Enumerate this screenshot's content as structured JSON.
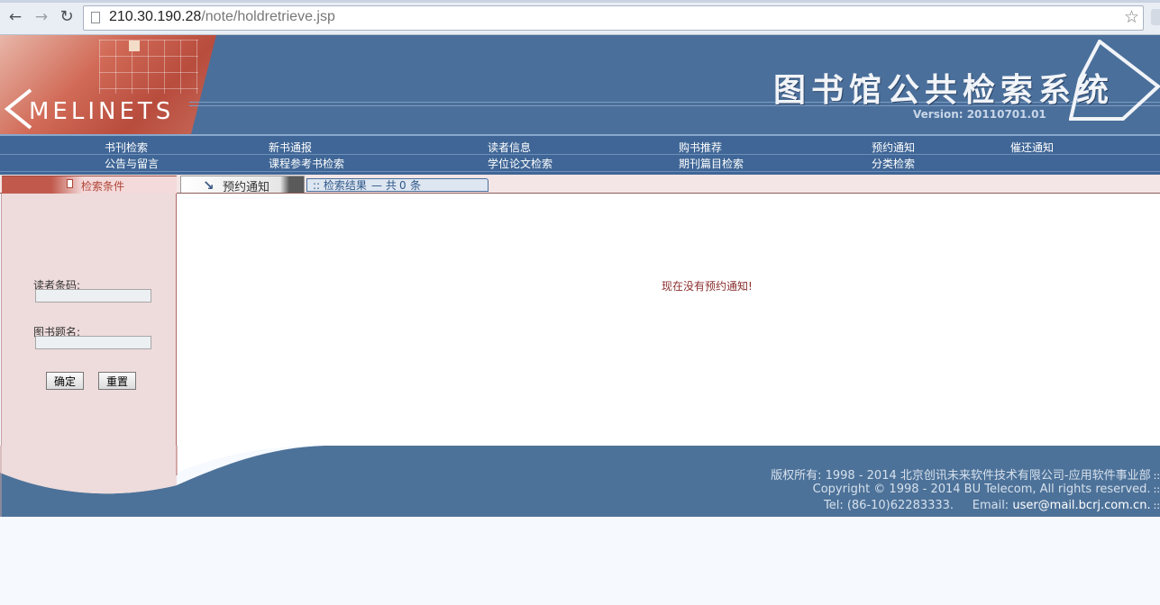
{
  "browser": {
    "url_host": "210.30.190.28",
    "url_path": "/note/holdretrieve.jsp"
  },
  "header": {
    "logo_text": "MELINETS",
    "system_title": "图书馆公共检索系统",
    "version": "Version: 20110701.01"
  },
  "menu": {
    "row1": [
      "书刊检索",
      "新书通报",
      "读者信息",
      "购书推荐",
      "预约通知",
      "催还通知"
    ],
    "row2": [
      "公告与留言",
      "课程参考书检索",
      "学位论文检索",
      "期刊篇目检索",
      "分类检索"
    ]
  },
  "tabs": {
    "search_conditions": "检索条件",
    "hold_notice": "预约通知",
    "result_prefix": ":: 检索结果",
    "result_total_label": "— 共",
    "result_count": "0",
    "result_unit": "条"
  },
  "form": {
    "reader_barcode_label": "读者条码:",
    "reader_barcode_value": "",
    "book_title_label": "图书题名:",
    "book_title_value": "",
    "confirm_button": "确定",
    "reset_button": "重置"
  },
  "main": {
    "empty_message": "现在没有预约通知!"
  },
  "footer": {
    "copyright_cn": "版权所有: 1998 - 2014 北京创讯未来软件技术有限公司-应用软件事业部",
    "copyright_en": "Copyright © 1998 - 2014 BU Telecom, All rights reserved.",
    "tel": "Tel: (86-10)62283333.",
    "email_label": "Email:",
    "email": "user@mail.bcrj.com.cn.",
    "dots": "::"
  },
  "colors": {
    "header_blue": "#4a6f9b",
    "menu_blue": "#3f6696",
    "panel_pink": "#eedbdb",
    "accent_red": "#b04437"
  }
}
